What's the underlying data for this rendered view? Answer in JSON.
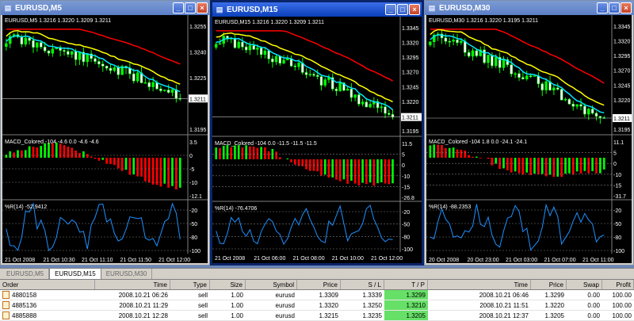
{
  "windows": [
    {
      "title": "EURUSD,M5",
      "ohlc_label": "EURUSD,M5  1.3216 1.3220 1.3209 1.3211",
      "price_labels": [
        "1.3255",
        "1.3240",
        "1.3225",
        "1.3211",
        "1.3195"
      ],
      "macd_label": "MACD_Colored  -104 -4.6 0.0 -4.6 -4.6",
      "macd_levels": [
        "3.5",
        "0",
        "-5",
        "-10",
        "-12.1"
      ],
      "wpr_label": "%R(14) -52.9412",
      "wpr_levels": [
        "-20",
        "-50",
        "-80",
        "-100"
      ],
      "time_labels": [
        "21 Oct 2008",
        "21 Oct 10:30",
        "21 Oct 11:10",
        "21 Oct 11:50",
        "21 Oct 12:00"
      ]
    },
    {
      "title": "EURUSD,M15",
      "ohlc_label": "EURUSD,M15  1.3216 1.3220 1.3209 1.3211",
      "price_labels": [
        "1.3345",
        "1.3320",
        "1.3295",
        "1.3270",
        "1.3245",
        "1.3220",
        "1.3211",
        "1.3195"
      ],
      "macd_label": "MACD_Colored  -104 0.0 -11.5 -11.5 -11.5",
      "macd_levels": [
        "11.5",
        "5",
        "0",
        "-10",
        "-15",
        "-26.8"
      ],
      "wpr_label": "%R(14) -76.4706",
      "wpr_levels": [
        "-20",
        "-50",
        "-80",
        "-100"
      ],
      "time_labels": [
        "21 Oct 2008",
        "21 Oct 06:00",
        "21 Oct 08:00",
        "21 Oct 10:00",
        "21 Oct 12:00"
      ]
    },
    {
      "title": "EURUSD,M30",
      "ohlc_label": "EURUSD,M30  1.3216 1.3220 1.3195 1.3211",
      "price_labels": [
        "1.3345",
        "1.3320",
        "1.3295",
        "1.3270",
        "1.3245",
        "1.3220",
        "1.3211",
        "1.3195"
      ],
      "macd_label": "MACD_Colored  -104 1.8 0.0 -24.1 -24.1",
      "macd_levels": [
        "11.1",
        "5",
        "0",
        "-10",
        "-15",
        "-31.7"
      ],
      "wpr_label": "%R(14) -88.2353",
      "wpr_levels": [
        "-20",
        "-50",
        "-80",
        "-100"
      ],
      "time_labels": [
        "20 Oct 2008",
        "20 Oct 23:00",
        "21 Oct 03:00",
        "21 Oct 07:00",
        "21 Oct 11:00"
      ]
    }
  ],
  "tabs": [
    "EURUSD,M5",
    "EURUSD,M15",
    "EURUSD,M30"
  ],
  "active_tab": "EURUSD,M15",
  "terminal": {
    "headers": [
      "Order",
      "Time",
      "Type",
      "Size",
      "Symbol",
      "Price",
      "S / L",
      "T / P",
      "Time",
      "Price",
      "Swap",
      "Profit"
    ],
    "rows": [
      [
        "4880158",
        "2008.10.21 06:26",
        "sell",
        "1.00",
        "eurusd",
        "1.3309",
        "1.3339",
        "1.3299",
        "2008.10.21 06:46",
        "1.3299",
        "0.00",
        "100.00"
      ],
      [
        "4885136",
        "2008.10.21 11:29",
        "sell",
        "1.00",
        "eurusd",
        "1.3320",
        "1.3250",
        "1.3210",
        "2008.10.21 11:51",
        "1.3220",
        "0.00",
        "100.00"
      ],
      [
        "4885888",
        "2008.10.21 12:28",
        "sell",
        "1.00",
        "eurusd",
        "1.3215",
        "1.3235",
        "1.3205",
        "2008.10.21 12:37",
        "1.3205",
        "0.00",
        "100.00"
      ]
    ]
  },
  "colors": {
    "bull": "#00ff00",
    "bear": "#ffffff",
    "ma_slow": "#ff0000",
    "ma_mid": "#ffff00",
    "ma_fast": "#00e5ff",
    "macd_up": "#00ff00",
    "macd_down": "#ff0000",
    "wpr": "#1e90ff",
    "tp_highlight": "#66e066"
  },
  "icons": {
    "window": "chart-window-icon",
    "minimize": "minimize-icon",
    "maximize": "maximize-icon",
    "close": "close-icon",
    "order": "order-icon"
  }
}
